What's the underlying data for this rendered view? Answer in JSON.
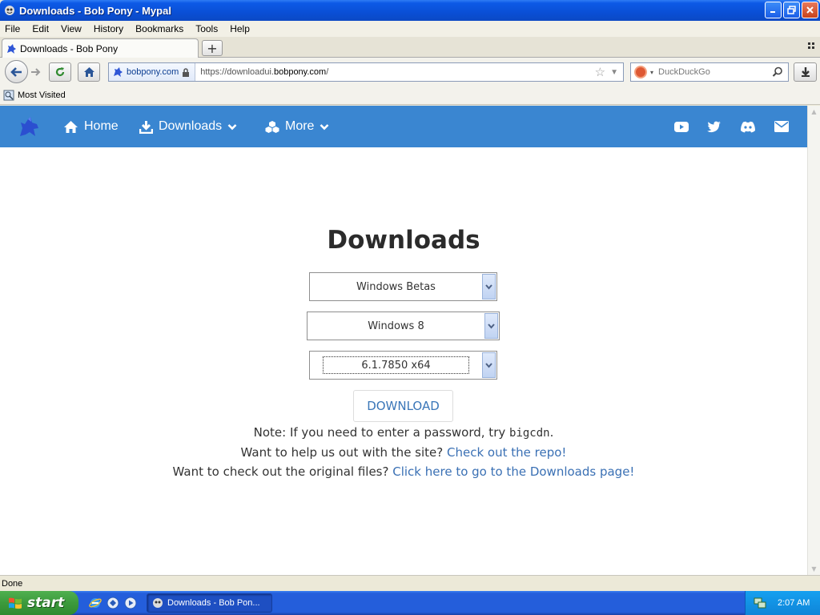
{
  "window": {
    "title": "Downloads - Bob Pony - Mypal"
  },
  "menubar": {
    "items": [
      "File",
      "Edit",
      "View",
      "History",
      "Bookmarks",
      "Tools",
      "Help"
    ]
  },
  "tabs": [
    {
      "label": "Downloads - Bob Pony",
      "active": true
    }
  ],
  "navbar": {
    "site_identity": "bobpony.com",
    "url_prefix": "https://downloadui.",
    "url_domain": "bobpony.com",
    "url_suffix": "/",
    "search_engine": "DuckDuckGo",
    "search_placeholder": "DuckDuckGo"
  },
  "bookmarks": {
    "items": [
      "Most Visited"
    ]
  },
  "site_nav": {
    "items": [
      {
        "label": "Home",
        "icon": "home-icon"
      },
      {
        "label": "Downloads",
        "icon": "download-icon",
        "has_dropdown": true
      },
      {
        "label": "More",
        "icon": "cubes-icon",
        "has_dropdown": true
      }
    ],
    "social_icons": [
      "youtube-icon",
      "twitter-icon",
      "discord-icon",
      "email-icon"
    ],
    "accent_color": "#3a86d1"
  },
  "main": {
    "heading": "Downloads",
    "selects": [
      {
        "name": "category",
        "value": "Windows Betas"
      },
      {
        "name": "product",
        "value": "Windows 8"
      },
      {
        "name": "build",
        "value": "6.1.7850 x64"
      }
    ],
    "download_button": "DOWNLOAD",
    "note_prefix": "Note: If you need to enter a password, try ",
    "note_password": "bigcdn",
    "note_suffix": ".",
    "help_prefix": "Want to help us out with the site? ",
    "help_link": "Check out the repo!",
    "original_prefix": "Want to check out the original files? ",
    "original_link": "Click here to go to the Downloads page!"
  },
  "statusbar": {
    "text": "Done"
  },
  "taskbar": {
    "start_label": "start",
    "task_label": "Downloads - Bob Pon...",
    "clock": "2:07 AM"
  }
}
